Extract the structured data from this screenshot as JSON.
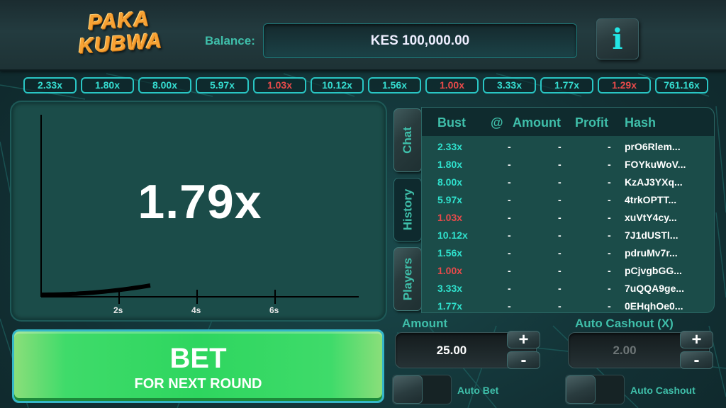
{
  "header": {
    "logo_line1": "PAKA",
    "logo_line2": "KUBWA",
    "balance_label": "Balance:",
    "balance_value": "KES 100,000.00",
    "info_icon": "i"
  },
  "history_strip": [
    {
      "value": "2.33x",
      "low": false
    },
    {
      "value": "1.80x",
      "low": false
    },
    {
      "value": "8.00x",
      "low": false
    },
    {
      "value": "5.97x",
      "low": false
    },
    {
      "value": "1.03x",
      "low": true
    },
    {
      "value": "10.12x",
      "low": false
    },
    {
      "value": "1.56x",
      "low": false
    },
    {
      "value": "1.00x",
      "low": true
    },
    {
      "value": "3.33x",
      "low": false
    },
    {
      "value": "1.77x",
      "low": false
    },
    {
      "value": "1.29x",
      "low": true
    },
    {
      "value": "761.16x",
      "low": false
    }
  ],
  "graph": {
    "multiplier": "1.79x",
    "x_ticks": [
      "2s",
      "4s",
      "6s"
    ],
    "elapsed_seconds": 2.8
  },
  "side_tabs": [
    {
      "label": "Chat",
      "active": false
    },
    {
      "label": "History",
      "active": true
    },
    {
      "label": "Players",
      "active": false
    }
  ],
  "table": {
    "headers": {
      "bust": "Bust",
      "at": "@",
      "amount": "Amount",
      "profit": "Profit",
      "hash": "Hash"
    },
    "rows": [
      {
        "bust": "2.33x",
        "low": false,
        "at": "-",
        "amount": "-",
        "profit": "-",
        "hash": "prO6Rlem..."
      },
      {
        "bust": "1.80x",
        "low": false,
        "at": "-",
        "amount": "-",
        "profit": "-",
        "hash": "FOYkuWoV..."
      },
      {
        "bust": "8.00x",
        "low": false,
        "at": "-",
        "amount": "-",
        "profit": "-",
        "hash": "KzAJ3YXq..."
      },
      {
        "bust": "5.97x",
        "low": false,
        "at": "-",
        "amount": "-",
        "profit": "-",
        "hash": "4trkOPTT..."
      },
      {
        "bust": "1.03x",
        "low": true,
        "at": "-",
        "amount": "-",
        "profit": "-",
        "hash": "xuVtY4cy..."
      },
      {
        "bust": "10.12x",
        "low": false,
        "at": "-",
        "amount": "-",
        "profit": "-",
        "hash": "7J1dUSTl..."
      },
      {
        "bust": "1.56x",
        "low": false,
        "at": "-",
        "amount": "-",
        "profit": "-",
        "hash": "pdruMv7r..."
      },
      {
        "bust": "1.00x",
        "low": true,
        "at": "-",
        "amount": "-",
        "profit": "-",
        "hash": "pCjvgbGG..."
      },
      {
        "bust": "3.33x",
        "low": false,
        "at": "-",
        "amount": "-",
        "profit": "-",
        "hash": "7uQQA9ge..."
      },
      {
        "bust": "1.77x",
        "low": false,
        "at": "-",
        "amount": "-",
        "profit": "-",
        "hash": "0EHqhOe0..."
      }
    ]
  },
  "controls": {
    "amount_label": "Amount",
    "amount_value": "25.00",
    "auto_cashout_label": "Auto Cashout (X)",
    "auto_cashout_value": "2.00",
    "plus": "+",
    "minus": "-",
    "auto_bet_label": "Auto Bet",
    "auto_cashout_toggle_label": "Auto Cashout",
    "auto_bet_on": false,
    "auto_cashout_on": false
  },
  "bet_button": {
    "main": "BET",
    "sub": "FOR NEXT ROUND"
  },
  "colors": {
    "accent": "#3fbfaa",
    "win": "#2fe0cc",
    "loss": "#e74a4a",
    "bet_green": "#2ed65f"
  }
}
